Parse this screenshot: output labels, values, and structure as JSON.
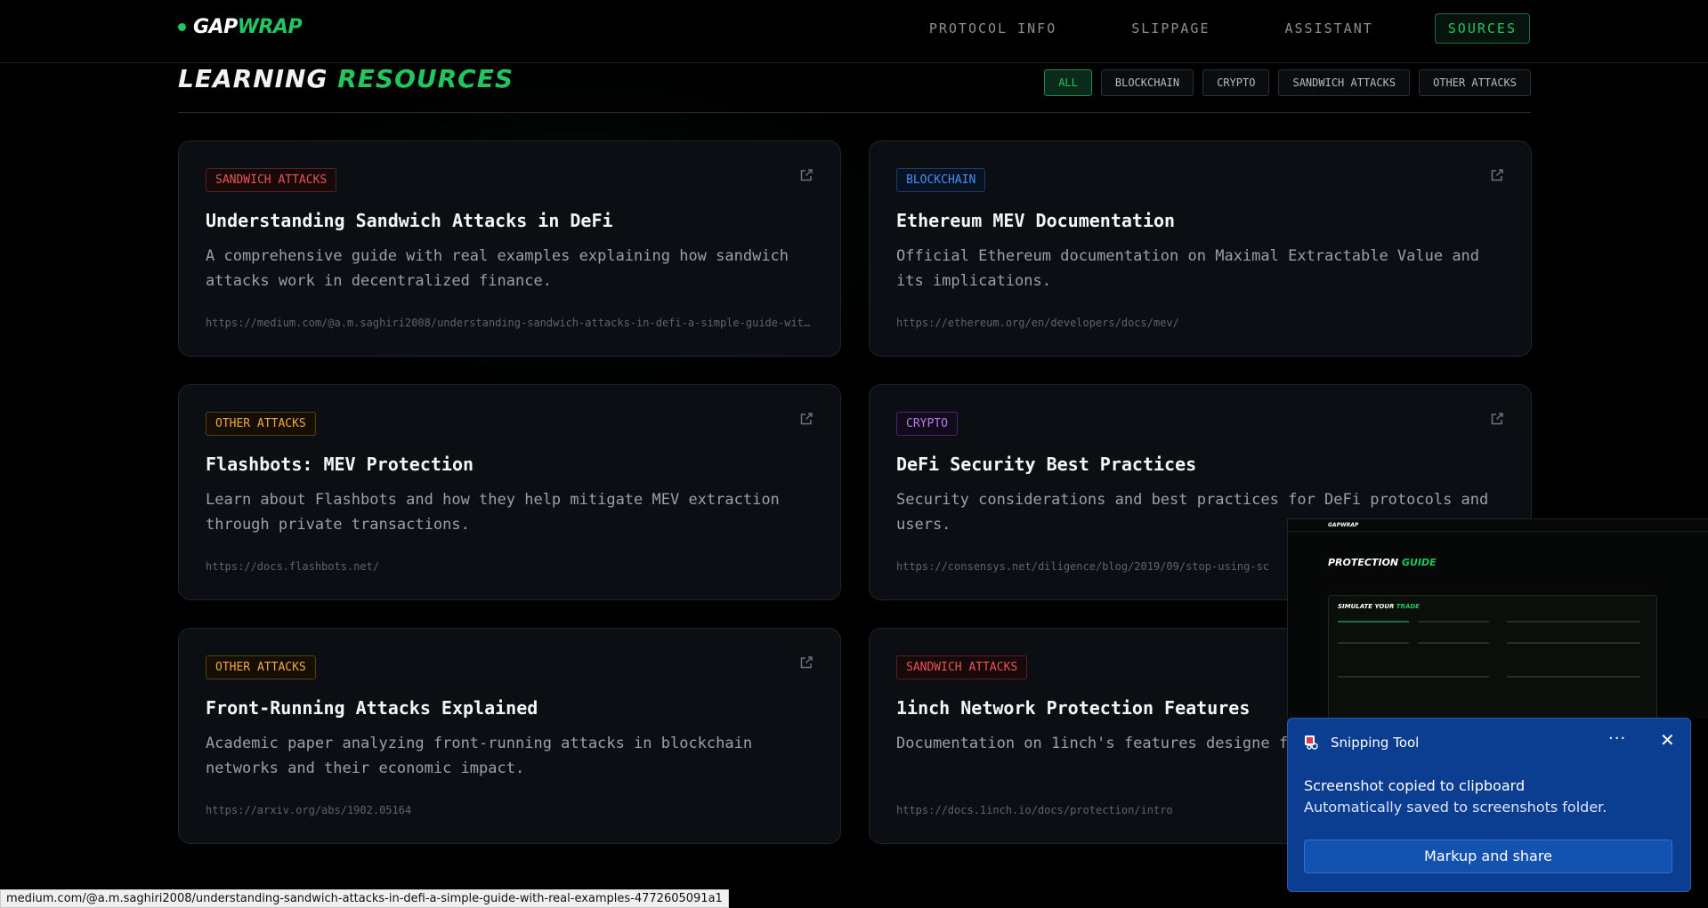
{
  "nav": {
    "logo_part1": "GAP",
    "logo_part2": "WRAP",
    "links": [
      "PROTOCOL INFO",
      "SLIPPAGE",
      "ASSISTANT",
      "SOURCES"
    ],
    "active": "SOURCES"
  },
  "section": {
    "title_part1": "LEARNING",
    "title_part2": "RESOURCES",
    "filters": [
      "ALL",
      "BLOCKCHAIN",
      "CRYPTO",
      "SANDWICH ATTACKS",
      "OTHER ATTACKS"
    ],
    "active_filter": "ALL"
  },
  "cards": [
    {
      "tag": "SANDWICH ATTACKS",
      "tag_kind": "sandwich",
      "title": "Understanding Sandwich Attacks in DeFi",
      "description": "A comprehensive guide with real examples explaining how sandwich attacks work in decentralized finance.",
      "url": "https://medium.com/@a.m.saghiri2008/understanding-sandwich-attacks-in-defi-a-simple-guide-with-real-examples-4772605091a1"
    },
    {
      "tag": "BLOCKCHAIN",
      "tag_kind": "blockchain",
      "title": "Ethereum MEV Documentation",
      "description": "Official Ethereum documentation on Maximal Extractable Value and its implications.",
      "url": "https://ethereum.org/en/developers/docs/mev/"
    },
    {
      "tag": "OTHER ATTACKS",
      "tag_kind": "other",
      "title": "Flashbots: MEV Protection",
      "description": "Learn about Flashbots and how they help mitigate MEV extraction through private transactions.",
      "url": "https://docs.flashbots.net/"
    },
    {
      "tag": "CRYPTO",
      "tag_kind": "crypto",
      "title": "DeFi Security Best Practices",
      "description": "Security considerations and best practices for DeFi protocols and users.",
      "url": "https://consensys.net/diligence/blog/2019/09/stop-using-sc"
    },
    {
      "tag": "OTHER ATTACKS",
      "tag_kind": "other",
      "title": "Front-Running Attacks Explained",
      "description": "Academic paper analyzing front-running attacks in blockchain networks and their economic impact.",
      "url": "https://arxiv.org/abs/1902.05164"
    },
    {
      "tag": "SANDWICH ATTACKS",
      "tag_kind": "sandwich",
      "title": "1inch Network Protection Features",
      "description": "Documentation on 1inch's features designe from MEV attacks.",
      "url": "https://docs.1inch.io/docs/protection/intro"
    }
  ],
  "status_bar": {
    "url": "medium.com/@a.m.saghiri2008/understanding-sandwich-attacks-in-defi-a-simple-guide-with-real-examples-4772605091a1"
  },
  "snip_preview": {
    "logo": "GAPWRAP",
    "title_part1": "PROTECTION",
    "title_part2": "GUIDE",
    "sub_part1": "SIMULATE YOUR",
    "sub_part2": "TRADE"
  },
  "toast": {
    "app_name": "Snipping Tool",
    "more": "···",
    "close": "✕",
    "message_line1": "Screenshot copied to clipboard",
    "message_line2": "Automatically saved to screenshots folder.",
    "button": "Markup and share"
  },
  "colors": {
    "accent": "#22c55e",
    "background": "#000000",
    "card": "#0b0f14",
    "toast": "#0b3d91"
  }
}
